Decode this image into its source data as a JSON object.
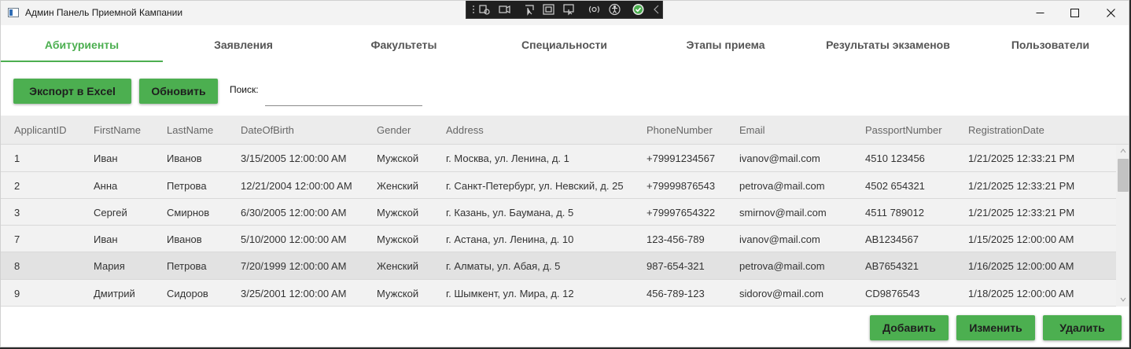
{
  "window": {
    "title": "Админ Панель Приемной Кампании"
  },
  "tabs": [
    {
      "label": "Абитуриенты"
    },
    {
      "label": "Заявления"
    },
    {
      "label": "Факультеты"
    },
    {
      "label": "Специальности"
    },
    {
      "label": "Этапы приема"
    },
    {
      "label": "Результаты экзаменов"
    },
    {
      "label": "Пользователи"
    }
  ],
  "toolbar": {
    "export_label": "Экспорт в Excel",
    "refresh_label": "Обновить",
    "search_label": "Поиск:",
    "search_value": ""
  },
  "grid": {
    "columns": [
      "ApplicantID",
      "FirstName",
      "LastName",
      "DateOfBirth",
      "Gender",
      "Address",
      "PhoneNumber",
      "Email",
      "PassportNumber",
      "RegistrationDate"
    ],
    "rows": [
      [
        "1",
        "Иван",
        "Иванов",
        "3/15/2005 12:00:00 AM",
        "Мужской",
        "г. Москва, ул. Ленина, д. 1",
        "+79991234567",
        "ivanov@mail.com",
        "4510 123456",
        "1/21/2025 12:33:21 PM"
      ],
      [
        "2",
        "Анна",
        "Петрова",
        "12/21/2004 12:00:00 AM",
        "Женский",
        "г. Санкт-Петербург, ул. Невский, д. 25",
        "+79999876543",
        "petrova@mail.com",
        "4502 654321",
        "1/21/2025 12:33:21 PM"
      ],
      [
        "3",
        "Сергей",
        "Смирнов",
        "6/30/2005 12:00:00 AM",
        "Мужской",
        "г. Казань, ул. Баумана, д. 5",
        "+79997654322",
        "smirnov@mail.com",
        "4511 789012",
        "1/21/2025 12:33:21 PM"
      ],
      [
        "7",
        "Иван",
        "Иванов",
        "5/10/2000 12:00:00 AM",
        "Мужской",
        "г. Астана, ул. Ленина, д. 10",
        "123-456-789",
        "ivanov@mail.com",
        "AB1234567",
        "1/15/2025 12:00:00 AM"
      ],
      [
        "8",
        "Мария",
        "Петрова",
        "7/20/1999 12:00:00 AM",
        "Женский",
        "г. Алматы, ул. Абая, д. 5",
        "987-654-321",
        "petrova@mail.com",
        "AB7654321",
        "1/16/2025 12:00:00 AM"
      ],
      [
        "9",
        "Дмитрий",
        "Сидоров",
        "3/25/2001 12:00:00 AM",
        "Мужской",
        "г. Шымкент, ул. Мира, д. 12",
        "456-789-123",
        "sidorov@mail.com",
        "CD9876543",
        "1/18/2025 12:00:00 AM"
      ]
    ],
    "selected_row_index": 4
  },
  "actions": {
    "add_label": "Добавить",
    "edit_label": "Изменить",
    "delete_label": "Удалить"
  },
  "colors": {
    "accent": "#4caf50",
    "header_bg": "#ececec",
    "row_bg": "#f2f2f2",
    "selected_row_bg": "#e2e2e2"
  },
  "icons": {
    "debug_toolbar": [
      "live-visual-tree-icon",
      "hot-reload-icon",
      "select-element-icon",
      "display-layout-adorners-icon",
      "track-focus-icon",
      "binding-failures-icon",
      "accessibility-icon",
      "checkmark-icon",
      "collapse-chevron-icon"
    ],
    "window_controls": [
      "minimize-icon",
      "maximize-icon",
      "close-icon"
    ]
  }
}
